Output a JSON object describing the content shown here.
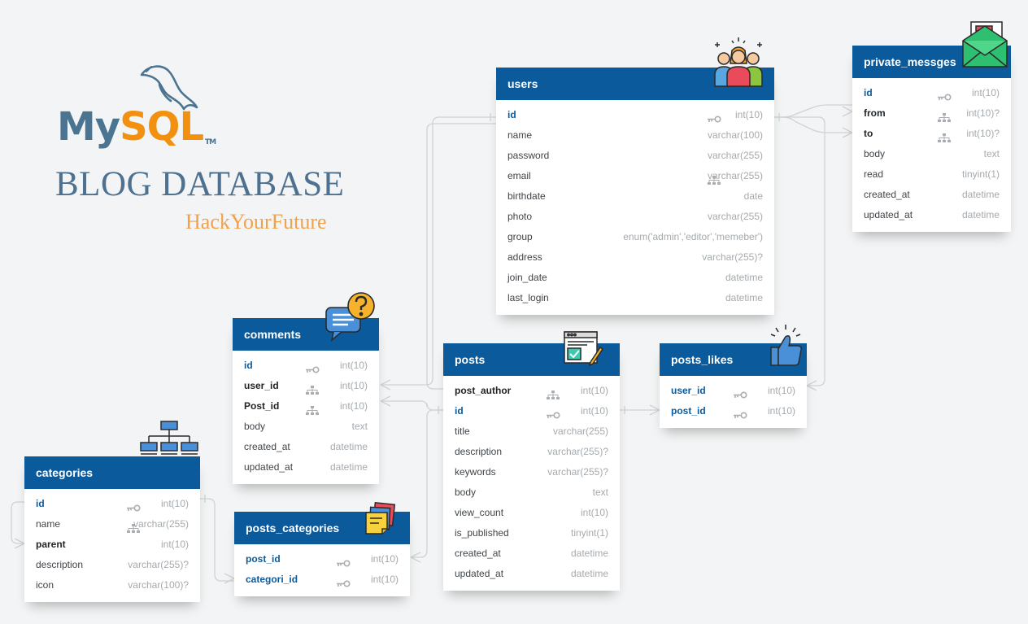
{
  "brand": {
    "logo_my": "My",
    "logo_sql": "SQL",
    "logo_tm": "TM",
    "title": "BLOG DATABASE",
    "subtitle": "HackYourFuture"
  },
  "colors": {
    "header": "#0b5a9c",
    "primary_key_text": "#0b5a9c",
    "type_text": "#a5aaae",
    "connector": "#cfd2d5",
    "background": "#f3f4f5",
    "brand_blue": "#4b7490",
    "brand_orange": "#f29111"
  },
  "tables": {
    "users": {
      "name": "users",
      "icon": "team-icon",
      "fields": [
        {
          "name": "id",
          "type": "int(10)",
          "key": "pk"
        },
        {
          "name": "name",
          "type": "varchar(100)",
          "key": ""
        },
        {
          "name": "password",
          "type": "varchar(255)",
          "key": ""
        },
        {
          "name": "email",
          "type": "varchar(255)",
          "key": "index"
        },
        {
          "name": "birthdate",
          "type": "date",
          "key": ""
        },
        {
          "name": "photo",
          "type": "varchar(255)",
          "key": ""
        },
        {
          "name": "group",
          "type": "enum('admin','editor','memeber')",
          "key": ""
        },
        {
          "name": "address",
          "type": "varchar(255)?",
          "key": ""
        },
        {
          "name": "join_date",
          "type": "datetime",
          "key": ""
        },
        {
          "name": "last_login",
          "type": "datetime",
          "key": ""
        }
      ]
    },
    "private_messges": {
      "name": "private_messges",
      "icon": "envelope-icon",
      "fields": [
        {
          "name": "id",
          "type": "int(10)",
          "key": "pk"
        },
        {
          "name": "from",
          "type": "int(10)?",
          "key": "fk"
        },
        {
          "name": "to",
          "type": "int(10)?",
          "key": "fk"
        },
        {
          "name": "body",
          "type": "text",
          "key": ""
        },
        {
          "name": "read",
          "type": "tinyint(1)",
          "key": ""
        },
        {
          "name": "created_at",
          "type": "datetime",
          "key": ""
        },
        {
          "name": "updated_at",
          "type": "datetime",
          "key": ""
        }
      ]
    },
    "comments": {
      "name": "comments",
      "icon": "chat-question-icon",
      "fields": [
        {
          "name": "id",
          "type": "int(10)",
          "key": "pk"
        },
        {
          "name": "user_id",
          "type": "int(10)",
          "key": "fk"
        },
        {
          "name": "Post_id",
          "type": "int(10)",
          "key": "fk"
        },
        {
          "name": "body",
          "type": "text",
          "key": ""
        },
        {
          "name": "created_at",
          "type": "datetime",
          "key": ""
        },
        {
          "name": "updated_at",
          "type": "datetime",
          "key": ""
        }
      ]
    },
    "posts": {
      "name": "posts",
      "icon": "browser-edit-icon",
      "fields": [
        {
          "name": "post_author",
          "type": "int(10)",
          "key": "fk"
        },
        {
          "name": "id",
          "type": "int(10)",
          "key": "pk"
        },
        {
          "name": "title",
          "type": "varchar(255)",
          "key": ""
        },
        {
          "name": "description",
          "type": "varchar(255)?",
          "key": ""
        },
        {
          "name": "keywords",
          "type": "varchar(255)?",
          "key": ""
        },
        {
          "name": "body",
          "type": "text",
          "key": ""
        },
        {
          "name": "view_count",
          "type": "int(10)",
          "key": ""
        },
        {
          "name": "is_published",
          "type": "tinyint(1)",
          "key": ""
        },
        {
          "name": "created_at",
          "type": "datetime",
          "key": ""
        },
        {
          "name": "updated_at",
          "type": "datetime",
          "key": ""
        }
      ]
    },
    "posts_likes": {
      "name": "posts_likes",
      "icon": "thumbs-up-icon",
      "fields": [
        {
          "name": "user_id",
          "type": "int(10)",
          "key": "pk"
        },
        {
          "name": "post_id",
          "type": "int(10)",
          "key": "pk"
        }
      ]
    },
    "categories": {
      "name": "categories",
      "icon": "hierarchy-icon",
      "fields": [
        {
          "name": "id",
          "type": "int(10)",
          "key": "pk"
        },
        {
          "name": "name",
          "type": "varchar(255)",
          "key": "index"
        },
        {
          "name": "parent",
          "type": "int(10)",
          "key": "fk-plain"
        },
        {
          "name": "description",
          "type": "varchar(255)?",
          "key": ""
        },
        {
          "name": "icon",
          "type": "varchar(100)?",
          "key": ""
        }
      ]
    },
    "posts_categories": {
      "name": "posts_categories",
      "icon": "sticky-notes-icon",
      "fields": [
        {
          "name": "post_id",
          "type": "int(10)",
          "key": "pk"
        },
        {
          "name": "categori_id",
          "type": "int(10)",
          "key": "pk"
        }
      ]
    }
  }
}
